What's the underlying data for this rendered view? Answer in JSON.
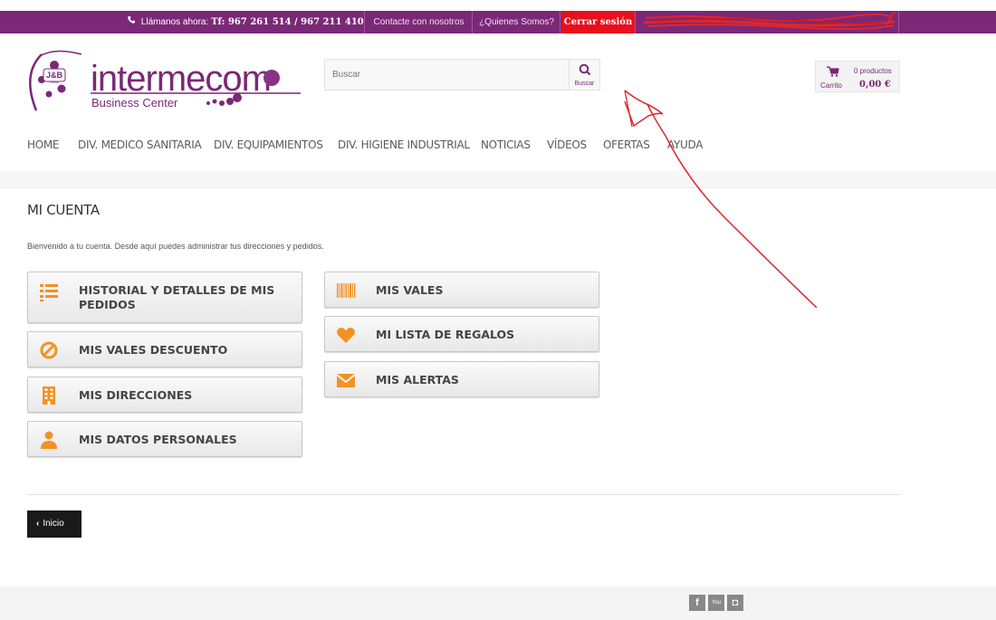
{
  "topbar": {
    "call_prefix": "Llámanos ahora:",
    "phones": "Tf: 967 261 514 / 967 211 410",
    "contact": "Contacte con nosotros",
    "about": "¿Quienes Somos?",
    "logout": "Cerrar sesión"
  },
  "logo": {
    "badge": "J&B",
    "badge_sub": "Group",
    "name": "intermecom",
    "tagline": "Business Center"
  },
  "search": {
    "placeholder": "Buscar",
    "button_label": "Buscar"
  },
  "cart": {
    "count": "0 productos",
    "label": "Carrito",
    "total": "0,00 €"
  },
  "nav": [
    "HOME",
    "DIV. MEDICO SANITARIA",
    "DIV. EQUIPAMIENTOS",
    "DIV. HIGIENE INDUSTRIAL",
    "NOTICIAS",
    "VÍDEOS",
    "OFERTAS",
    "AYUDA"
  ],
  "page": {
    "title": "MI CUENTA",
    "welcome": "Bienvenido a tu cuenta. Desde aquí puedes administrar tus direcciones y pedidos."
  },
  "account_links": {
    "history": "HISTORIAL Y DETALLES DE MIS PEDIDOS",
    "vouchers_discount": "MIS VALES DESCUENTO",
    "addresses": "MIS DIRECCIONES",
    "personal": "MIS DATOS PERSONALES",
    "vouchers": "MIS VALES",
    "gift_list": "MI LISTA DE REGALOS",
    "alerts": "MIS ALERTAS"
  },
  "home_button": "Inicio",
  "social": {
    "facebook": "f",
    "youtube": "You",
    "instagram": "◘"
  },
  "colors": {
    "brand_purple": "#7b2877",
    "logout_red": "#e8101d",
    "icon_orange": "#f39224",
    "annotation_red": "#e0262b"
  }
}
